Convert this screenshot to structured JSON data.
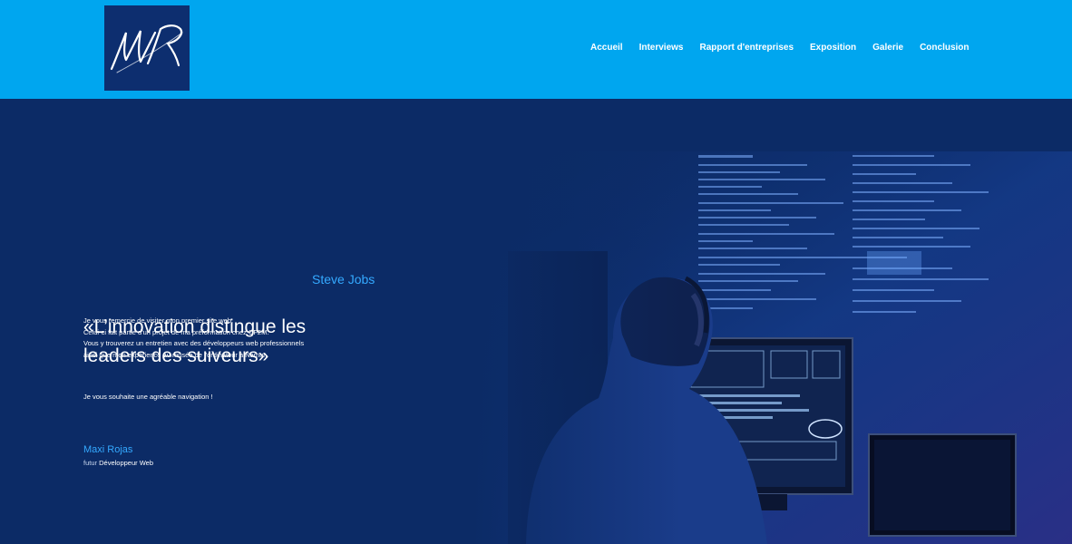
{
  "header": {
    "logo_alt": "MR",
    "nav": [
      "Accueil",
      "Interviews",
      "Rapport d'entreprises",
      "Exposition",
      "Galerie",
      "Conclusion"
    ]
  },
  "hero": {
    "quote_line1": "«L’innovation distingue les",
    "quote_line2": "leaders des suiveurs»",
    "quote_author": "Steve Jobs",
    "intro_lines": [
      "Je vous remercie de visiter mon premier site web.",
      "Celui-ci fait partie d'un projet de ma préformation chez CF2M.",
      "Vous y trouverez un entretien avec des développeurs web professionnels",
      "ainsi que mon expérience au musée de l'ordinateur à Namur."
    ],
    "wish": "Je vous souhaite une agréable navigation !",
    "signature_name": "Maxi Rojas",
    "signature_prefix": "futur",
    "signature_role": "Développeur Web"
  },
  "colors": {
    "header_bg": "#00a6ef",
    "hero_bg": "#0c2b66",
    "accent": "#34a9ff",
    "logo_bg": "#0d2e6f"
  }
}
